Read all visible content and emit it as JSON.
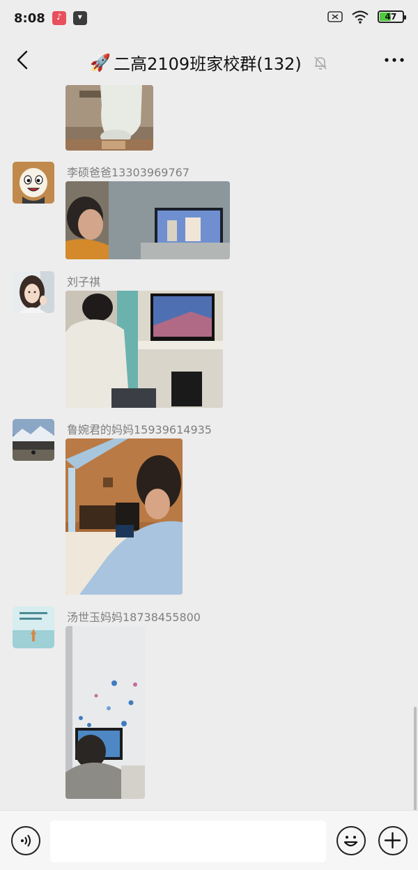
{
  "status": {
    "time": "8:08",
    "battery_percent": "47",
    "battery_level": 0.47
  },
  "header": {
    "emoji": "🚀",
    "title": "二高2109班家校群(132)",
    "back_icon": "chevron-left-icon",
    "mute_icon": "bell-off-icon",
    "more_icon": "ellipsis-icon"
  },
  "messages": [
    {
      "sender": "",
      "type": "image"
    },
    {
      "sender": "李硕爸爸13303969767",
      "type": "image"
    },
    {
      "sender": "刘子祺",
      "type": "image"
    },
    {
      "sender": "鲁婉君的妈妈15939614935",
      "type": "image"
    },
    {
      "sender": "汤世玉妈妈18738455800",
      "type": "image"
    }
  ],
  "input": {
    "value": "",
    "placeholder": ""
  }
}
